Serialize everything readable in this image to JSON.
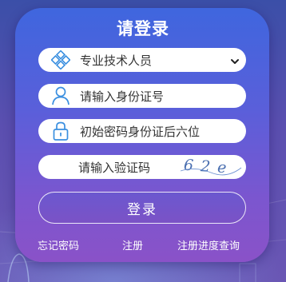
{
  "login": {
    "title": "请登录",
    "category_select": {
      "value": "专业技术人员",
      "icon": "lattice-icon"
    },
    "id_field": {
      "placeholder": "请输入身份证号",
      "icon": "user-icon"
    },
    "password_field": {
      "placeholder": "初始密码身份证后六位",
      "icon": "lock-icon"
    },
    "captcha_field": {
      "placeholder": "请输入验证码",
      "captcha_value": "62e"
    },
    "submit_label": "登录"
  },
  "footer_links": {
    "forgot_password": "忘记密码",
    "register": "注册",
    "register_progress": "注册进度查询"
  },
  "colors": {
    "icon_blue": "#3a8fe0",
    "panel_top": "#3f66de",
    "panel_bottom": "#8a52c8"
  }
}
